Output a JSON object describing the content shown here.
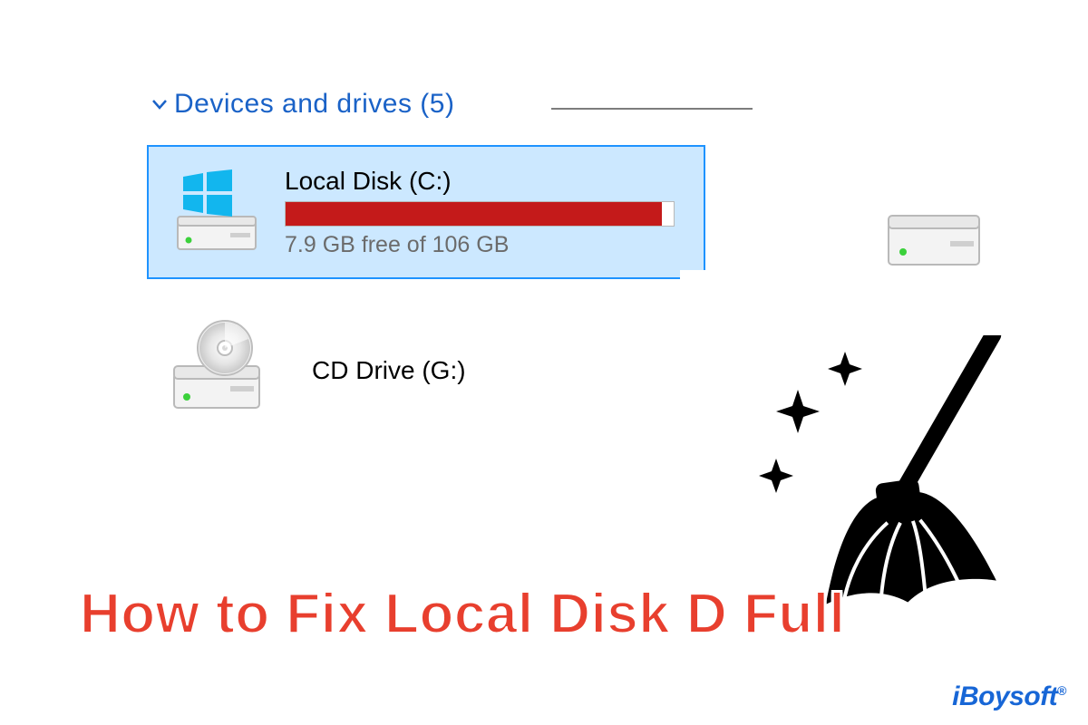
{
  "section": {
    "title": "Devices and drives (5)"
  },
  "drive_c": {
    "name": "Local Disk (C:)",
    "subtext": "7.9 GB free of 106 GB",
    "usage_percent": 93
  },
  "cd_drive": {
    "name": "CD Drive (G:)"
  },
  "headline": "How to Fix Local Disk D Full",
  "brand": "iBoysoft"
}
